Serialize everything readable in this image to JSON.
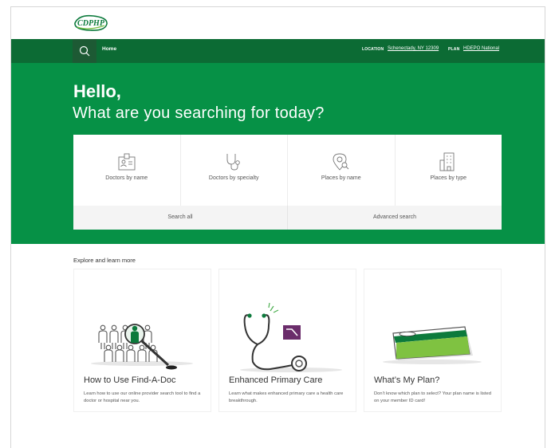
{
  "brand": {
    "logo_text": "CDPHP",
    "green": "#069146",
    "dark_green": "#0c6b34"
  },
  "nav": {
    "search_icon": "search-icon",
    "home": "Home",
    "location_label": "LOCATION",
    "location_value": "Schenectady, NY 12309",
    "plan_label": "PLAN",
    "plan_value": "HDEPO National"
  },
  "hero": {
    "greeting": "Hello,",
    "subtitle": "What are you searching for today?"
  },
  "search_cards": [
    {
      "label": "Doctors by name",
      "icon": "id-badge-icon"
    },
    {
      "label": "Doctors by specialty",
      "icon": "stethoscope-icon"
    },
    {
      "label": "Places by name",
      "icon": "map-pin-search-icon"
    },
    {
      "label": "Places by type",
      "icon": "building-icon"
    }
  ],
  "search_links": {
    "all": "Search all",
    "advanced": "Advanced search"
  },
  "explore": {
    "heading": "Explore and learn more",
    "cards": [
      {
        "title": "How to Use Find-A-Doc",
        "description": "Learn how to use our online provider search tool to find a doctor or hospital near you."
      },
      {
        "title": "Enhanced Primary Care",
        "description": "Learn what makes enhanced primary care a health care breakthrough."
      },
      {
        "title": "What’s My Plan?",
        "description": "Don’t know which plan to select? Your plan name is listed on your member ID card!"
      }
    ]
  }
}
